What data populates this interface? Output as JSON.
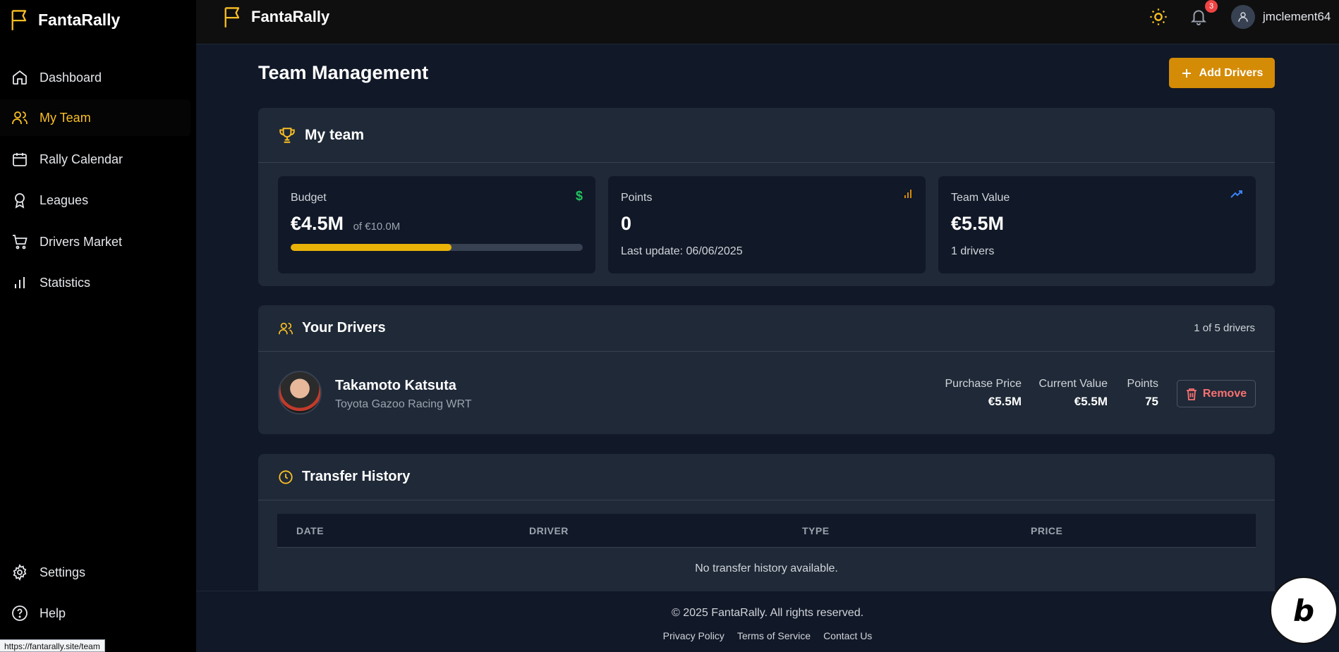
{
  "app": {
    "brand": "FantaRally"
  },
  "sidebar": {
    "items": [
      {
        "label": "Dashboard",
        "icon": "home-icon"
      },
      {
        "label": "My Team",
        "icon": "users-icon"
      },
      {
        "label": "Rally Calendar",
        "icon": "calendar-icon"
      },
      {
        "label": "Leagues",
        "icon": "award-icon"
      },
      {
        "label": "Drivers Market",
        "icon": "cart-icon"
      },
      {
        "label": "Statistics",
        "icon": "bar-chart-icon"
      }
    ],
    "bottom_items": [
      {
        "label": "Settings",
        "icon": "gear-icon"
      },
      {
        "label": "Help",
        "icon": "help-icon"
      }
    ]
  },
  "topbar": {
    "brand": "FantaRally",
    "notification_count": "3",
    "username": "jmclement64"
  },
  "page": {
    "title": "Team Management",
    "add_button": "Add Drivers"
  },
  "my_team": {
    "title": "My team",
    "budget": {
      "label": "Budget",
      "value": "€4.5M",
      "of": "of €10.0M",
      "used_fraction": 0.55
    },
    "points": {
      "label": "Points",
      "value": "0",
      "sub": "Last update: 06/06/2025"
    },
    "team_value": {
      "label": "Team Value",
      "value": "€5.5M",
      "sub": "1 drivers"
    }
  },
  "drivers": {
    "title": "Your Drivers",
    "count_text": "1 of 5 drivers",
    "list": [
      {
        "name": "Takamoto Katsuta",
        "team": "Toyota Gazoo Racing WRT",
        "purchase_label": "Purchase Price",
        "purchase_value": "€5.5M",
        "current_label": "Current Value",
        "current_value": "€5.5M",
        "points_label": "Points",
        "points_value": "75",
        "remove_label": "Remove"
      }
    ]
  },
  "transfers": {
    "title": "Transfer History",
    "columns": [
      "DATE",
      "DRIVER",
      "TYPE",
      "PRICE"
    ],
    "empty": "No transfer history available."
  },
  "footer": {
    "copyright": "© 2025 FantaRally. All rights reserved.",
    "links": [
      "Privacy Policy",
      "Terms of Service",
      "Contact Us"
    ]
  },
  "statusbar": {
    "url": "https://fantarally.site/team"
  },
  "colors": {
    "accent": "#fbbf24",
    "button": "#d48b06",
    "danger": "#f87171",
    "budget_icon": "#22c55e",
    "trend_icon": "#3b82f6"
  }
}
